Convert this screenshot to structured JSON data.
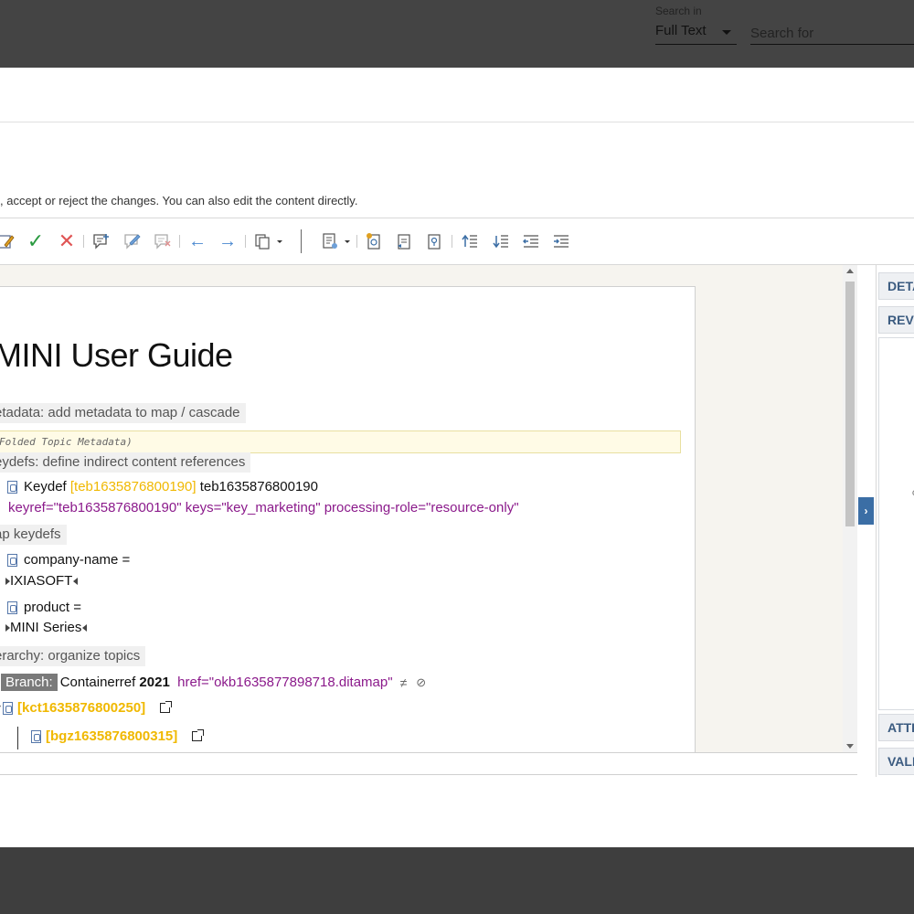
{
  "search": {
    "scope_label": "Search in",
    "scope_value": "Full Text",
    "placeholder": "Search for"
  },
  "dialog": {
    "instructions": ", accept or reject the changes. You can also edit the content directly."
  },
  "toolbar": {
    "icons": [
      "track-changes-icon",
      "accept-change-icon",
      "reject-change-icon",
      "add-comment-icon",
      "edit-comment-icon",
      "remove-comment-icon",
      "previous-change-icon",
      "next-change-icon",
      "review-actions-dropdown-icon",
      "show-map-dropdown-icon",
      "insert-topicref-icon",
      "insert-topic-icon",
      "insert-keydef-icon",
      "move-up-icon",
      "move-down-icon",
      "promote-icon",
      "demote-icon"
    ]
  },
  "document": {
    "title": "MINI User Guide",
    "metadata_section": "etadata: add metadata to map / cascade",
    "folded_metadata": "Folded Topic Metadata)",
    "keydefs_section": "eydefs: define indirect content references",
    "keydef": {
      "label": "Keydef",
      "id_bracket": "[teb1635876800190]",
      "id": "teb1635876800190",
      "attrs": "keyref=\"teb1635876800190\" keys=\"key_marketing\" processing-role=\"resource-only\""
    },
    "map_keydefs_section": "ap keydefs",
    "company": {
      "label": "company-name =",
      "value": "IXIASOFT"
    },
    "product": {
      "label": "product =",
      "value": "MINI Series"
    },
    "hierarchy_section": "erarchy: organize topics",
    "branch": {
      "tag": "Branch:",
      "label": "Containerref",
      "year": "2021",
      "href": "href=\"okb1635877898718.ditamap\""
    },
    "topic1": "[kct1635876800250]",
    "topic2": "[bgz1635876800315]"
  },
  "side_panel": {
    "tabs": [
      "DETA",
      "REVI",
      "ATTR",
      "VALI"
    ],
    "toggle": "›"
  },
  "colors": {
    "accent": "#3b6ea5",
    "attribute": "#8b1a8b",
    "key_id": "#f0b800"
  }
}
